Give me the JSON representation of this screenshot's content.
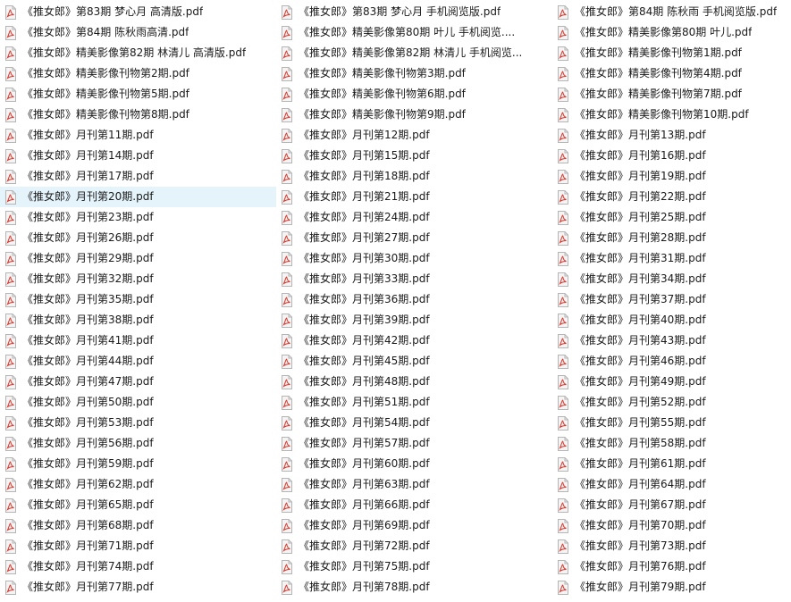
{
  "view": {
    "selected_index": 9,
    "icon": "pdf-file-icon",
    "colors": {
      "icon_body": "#f4f4f4",
      "icon_border": "#b5b5b5",
      "icon_accent": "#d9362b",
      "selection": "#e5f3fb"
    }
  },
  "files": [
    "《推女郎》第83期 梦心月 高清版.pdf",
    "《推女郎》第84期 陈秋雨高清.pdf",
    "《推女郎》精美影像第82期 林清儿 高清版.pdf",
    "《推女郎》精美影像刊物第2期.pdf",
    "《推女郎》精美影像刊物第5期.pdf",
    "《推女郎》精美影像刊物第8期.pdf",
    "《推女郎》月刊第11期.pdf",
    "《推女郎》月刊第14期.pdf",
    "《推女郎》月刊第17期.pdf",
    "《推女郎》月刊第20期.pdf",
    "《推女郎》月刊第23期.pdf",
    "《推女郎》月刊第26期.pdf",
    "《推女郎》月刊第29期.pdf",
    "《推女郎》月刊第32期.pdf",
    "《推女郎》月刊第35期.pdf",
    "《推女郎》月刊第38期.pdf",
    "《推女郎》月刊第41期.pdf",
    "《推女郎》月刊第44期.pdf",
    "《推女郎》月刊第47期.pdf",
    "《推女郎》月刊第50期.pdf",
    "《推女郎》月刊第53期.pdf",
    "《推女郎》月刊第56期.pdf",
    "《推女郎》月刊第59期.pdf",
    "《推女郎》月刊第62期.pdf",
    "《推女郎》月刊第65期.pdf",
    "《推女郎》月刊第68期.pdf",
    "《推女郎》月刊第71期.pdf",
    "《推女郎》月刊第74期.pdf",
    "《推女郎》月刊第77期.pdf",
    "《推女郎》第83期 梦心月 手机阅览版.pdf",
    "《推女郎》精美影像第80期 叶儿 手机阅览....",
    "《推女郎》精美影像第82期 林清儿 手机阅览...",
    "《推女郎》精美影像刊物第3期.pdf",
    "《推女郎》精美影像刊物第6期.pdf",
    "《推女郎》精美影像刊物第9期.pdf",
    "《推女郎》月刊第12期.pdf",
    "《推女郎》月刊第15期.pdf",
    "《推女郎》月刊第18期.pdf",
    "《推女郎》月刊第21期.pdf",
    "《推女郎》月刊第24期.pdf",
    "《推女郎》月刊第27期.pdf",
    "《推女郎》月刊第30期.pdf",
    "《推女郎》月刊第33期.pdf",
    "《推女郎》月刊第36期.pdf",
    "《推女郎》月刊第39期.pdf",
    "《推女郎》月刊第42期.pdf",
    "《推女郎》月刊第45期.pdf",
    "《推女郎》月刊第48期.pdf",
    "《推女郎》月刊第51期.pdf",
    "《推女郎》月刊第54期.pdf",
    "《推女郎》月刊第57期.pdf",
    "《推女郎》月刊第60期.pdf",
    "《推女郎》月刊第63期.pdf",
    "《推女郎》月刊第66期.pdf",
    "《推女郎》月刊第69期.pdf",
    "《推女郎》月刊第72期.pdf",
    "《推女郎》月刊第75期.pdf",
    "《推女郎》月刊第78期.pdf",
    "《推女郎》第84期 陈秋雨 手机阅览版.pdf",
    "《推女郎》精美影像第80期 叶儿.pdf",
    "《推女郎》精美影像刊物第1期.pdf",
    "《推女郎》精美影像刊物第4期.pdf",
    "《推女郎》精美影像刊物第7期.pdf",
    "《推女郎》精美影像刊物第10期.pdf",
    "《推女郎》月刊第13期.pdf",
    "《推女郎》月刊第16期.pdf",
    "《推女郎》月刊第19期.pdf",
    "《推女郎》月刊第22期.pdf",
    "《推女郎》月刊第25期.pdf",
    "《推女郎》月刊第28期.pdf",
    "《推女郎》月刊第31期.pdf",
    "《推女郎》月刊第34期.pdf",
    "《推女郎》月刊第37期.pdf",
    "《推女郎》月刊第40期.pdf",
    "《推女郎》月刊第43期.pdf",
    "《推女郎》月刊第46期.pdf",
    "《推女郎》月刊第49期.pdf",
    "《推女郎》月刊第52期.pdf",
    "《推女郎》月刊第55期.pdf",
    "《推女郎》月刊第58期.pdf",
    "《推女郎》月刊第61期.pdf",
    "《推女郎》月刊第64期.pdf",
    "《推女郎》月刊第67期.pdf",
    "《推女郎》月刊第70期.pdf",
    "《推女郎》月刊第73期.pdf",
    "《推女郎》月刊第76期.pdf",
    "《推女郎》月刊第79期.pdf"
  ]
}
